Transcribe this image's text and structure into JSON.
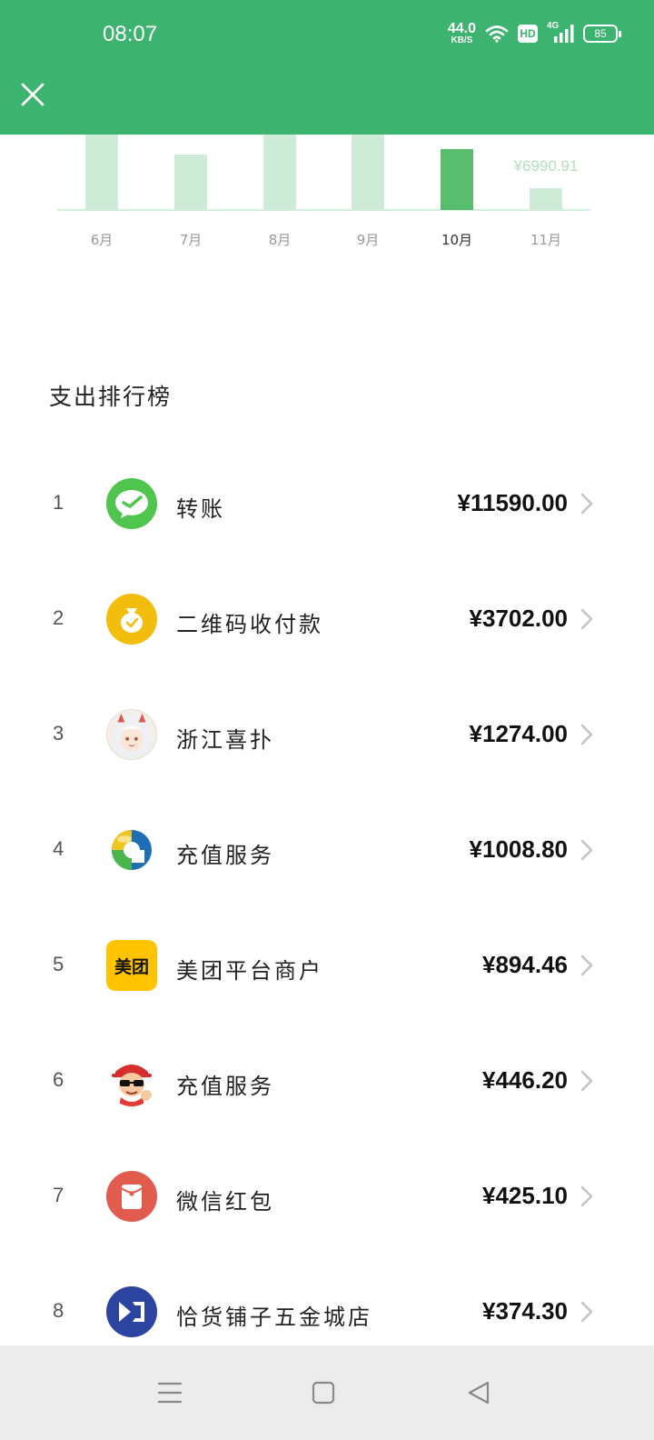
{
  "status_bar": {
    "time": "08:07",
    "net_speed_value": "44.0",
    "net_speed_unit": "KB/S",
    "hd_label": "HD",
    "network_label": "4G",
    "battery_level": "85"
  },
  "header": {
    "close_icon": "close-icon",
    "color": "#3db370"
  },
  "chart_data": {
    "type": "bar",
    "categories": [
      "6月",
      "7月",
      "8月",
      "9月",
      "10月",
      "11月"
    ],
    "highlight_index": 4,
    "highlight_color": "#58bd6e",
    "base_color": "#cdebd6",
    "visible_label": "¥6990.91",
    "visible_label_index": 5
  },
  "section": {
    "title": "支出排行榜"
  },
  "ranking": [
    {
      "rank": "1",
      "name": "转账",
      "amount": "¥11590.00",
      "icon": "transfer-icon"
    },
    {
      "rank": "2",
      "name": "二维码收付款",
      "amount": "¥3702.00",
      "icon": "qr-payment-icon"
    },
    {
      "rank": "3",
      "name": "浙江喜扑",
      "amount": "¥1274.00",
      "icon": "merchant-avatar-icon"
    },
    {
      "rank": "4",
      "name": "充值服务",
      "amount": "¥1008.80",
      "icon": "recharge-service-icon"
    },
    {
      "rank": "5",
      "name": "美团平台商户",
      "amount": "¥894.46",
      "icon": "meituan-icon",
      "icon_text": "美团"
    },
    {
      "rank": "6",
      "name": "充值服务",
      "amount": "¥446.20",
      "icon": "cartoon-avatar-icon"
    },
    {
      "rank": "7",
      "name": "微信红包",
      "amount": "¥425.10",
      "icon": "red-packet-icon"
    },
    {
      "rank": "8",
      "name": "恰货铺子五金城店",
      "amount": "¥374.30",
      "icon": "store-logo-icon"
    }
  ],
  "nav": {
    "menu_icon": "menu-icon",
    "home_icon": "home-icon",
    "back_icon": "back-icon"
  }
}
